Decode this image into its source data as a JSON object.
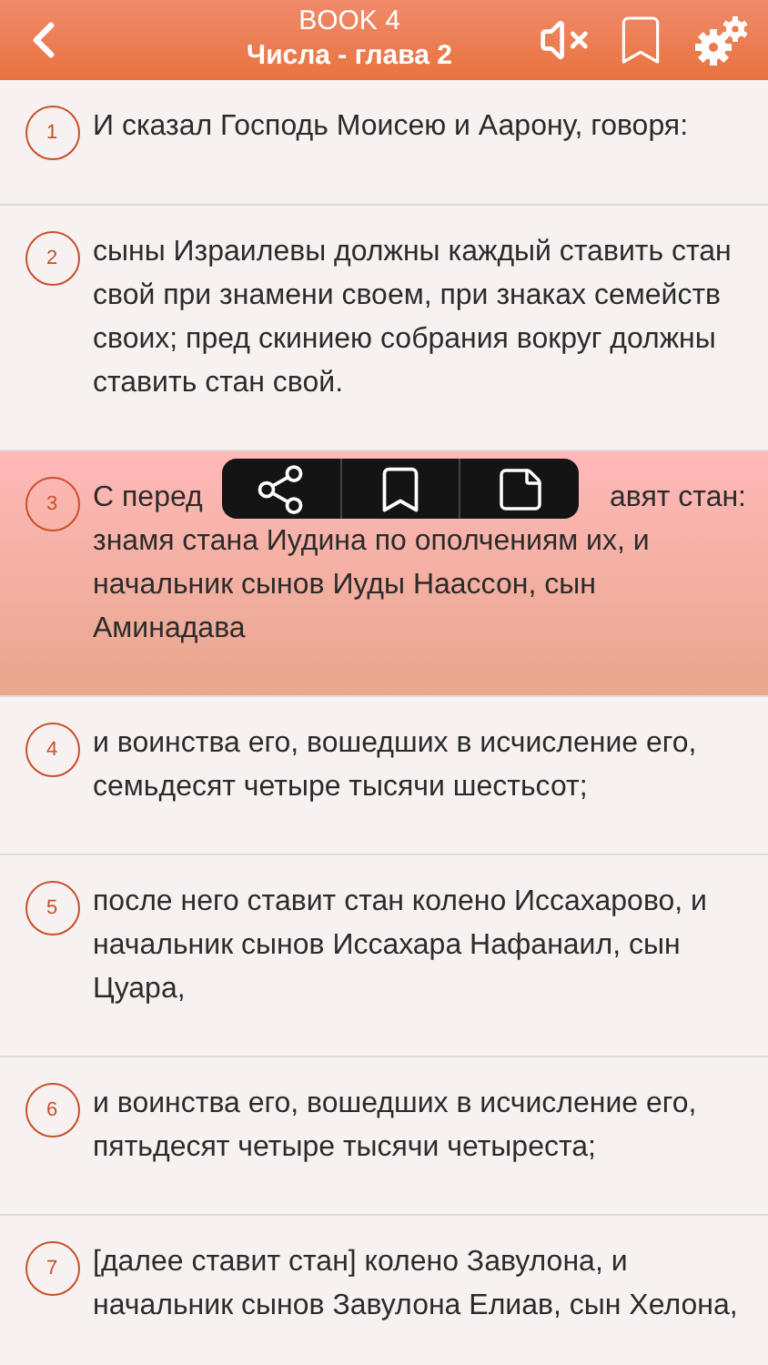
{
  "header": {
    "title": "BOOK 4",
    "subtitle": "Числа - глава 2"
  },
  "verses": [
    {
      "number": "1",
      "text": "И сказал Господь Моисею и Аарону, говоря:",
      "selected": false
    },
    {
      "number": "2",
      "text": "сыны Израилевы должны каждый ставить стан свой при знамени своем, при знаках семейств своих; пред скиниею собрания вокруг должны ставить стан свой.",
      "selected": false
    },
    {
      "number": "3",
      "first_line_start": "С перед",
      "first_line_end": "авят стан:",
      "text": "знамя стана Иудина по ополчениям их, и начальник сынов Иуды Наассон, сын Аминадава",
      "selected": true
    },
    {
      "number": "4",
      "text": "и воинства его, вошедших в исчисление его, семьдесят четыре тысячи шестьсот;",
      "selected": false
    },
    {
      "number": "5",
      "text": "после него ставит стан колено Иссахарово, и начальник сынов Иссахара Нафанаил, сын Цуара,",
      "selected": false
    },
    {
      "number": "6",
      "text": "и воинства его, вошедших в исчисление его, пятьдесят четыре тысячи четыреста;",
      "selected": false
    },
    {
      "number": "7",
      "text": "[далее ставит стан] колено Завулона, и начальник сынов Завулона Елиав, сын Хелона,",
      "selected": false
    }
  ]
}
